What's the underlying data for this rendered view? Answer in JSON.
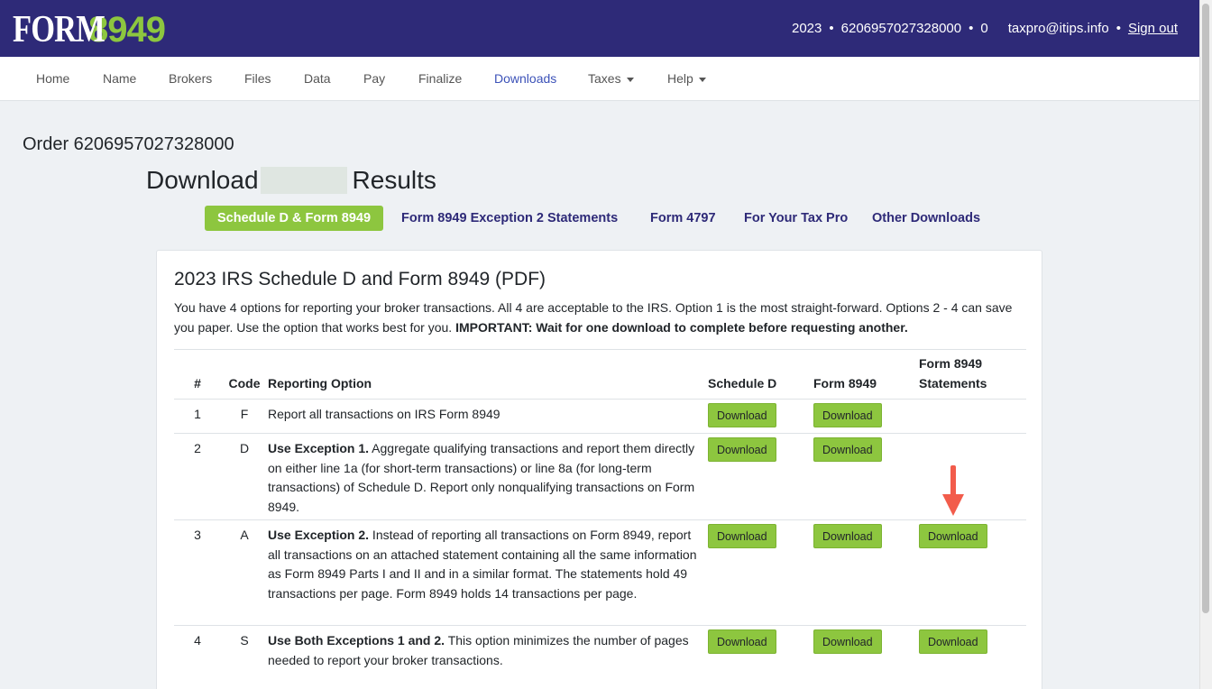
{
  "logo": {
    "form": "FORM",
    "number": "8949"
  },
  "header": {
    "year": "2023",
    "order_id": "6206957027328000",
    "count": "0",
    "separator": "•",
    "email": "taxpro@itips.info",
    "sign_out": "Sign out"
  },
  "nav": {
    "items": [
      {
        "label": "Home"
      },
      {
        "label": "Name"
      },
      {
        "label": "Brokers"
      },
      {
        "label": "Files"
      },
      {
        "label": "Data"
      },
      {
        "label": "Pay"
      },
      {
        "label": "Finalize"
      },
      {
        "label": "Downloads"
      },
      {
        "label": "Taxes"
      },
      {
        "label": "Help"
      }
    ]
  },
  "page": {
    "order_title": "Order 6206957027328000",
    "download_word": "Download",
    "results_word": "Results"
  },
  "tabs": [
    {
      "label": "Schedule D & Form 8949"
    },
    {
      "label": "Form 8949 Exception 2 Statements"
    },
    {
      "label": "Form 4797"
    },
    {
      "label": "For Your Tax Pro"
    },
    {
      "label": "Other Downloads"
    }
  ],
  "card": {
    "title": "2023 IRS Schedule D and Form 8949 (PDF)",
    "intro": "You have 4 options for reporting your broker transactions. All 4 are acceptable to the IRS. Option 1 is the most straight-forward. Options 2 - 4 can save you paper. Use the option that works best for you.",
    "intro_important": "IMPORTANT: Wait for one download to complete before requesting another."
  },
  "table": {
    "headers": {
      "num": "#",
      "code": "Code",
      "option": "Reporting Option",
      "schedule_d": "Schedule D",
      "form_8949": "Form 8949",
      "statements_line1": "Form 8949",
      "statements_line2": "Statements"
    },
    "download_label": "Download",
    "rows": [
      {
        "num": "1",
        "code": "F",
        "bold": "",
        "text": "Report all transactions on IRS Form 8949"
      },
      {
        "num": "2",
        "code": "D",
        "bold": "Use Exception 1.",
        "text": " Aggregate qualifying transactions and report them directly on either line 1a (for short-term transactions) or line 8a (for long-term transactions) of Schedule D. Report only nonqualifying transactions on Form 8949."
      },
      {
        "num": "3",
        "code": "A",
        "bold": "Use Exception 2.",
        "text": " Instead of reporting all transactions on Form 8949, report all transactions on an attached statement containing all the same information as Form 8949 Parts I and II and in a similar format. The statements hold 49 transactions per page. Form 8949 holds 14 transactions per page."
      },
      {
        "num": "4",
        "code": "S",
        "bold": "Use Both Exceptions 1 and 2.",
        "text": " This option minimizes the number of pages needed to report your broker transactions."
      }
    ]
  },
  "colors": {
    "header_bg": "#2e2a78",
    "accent_green": "#8dc63f",
    "nav_active": "#3c52b8",
    "arrow": "#f25c4b"
  }
}
